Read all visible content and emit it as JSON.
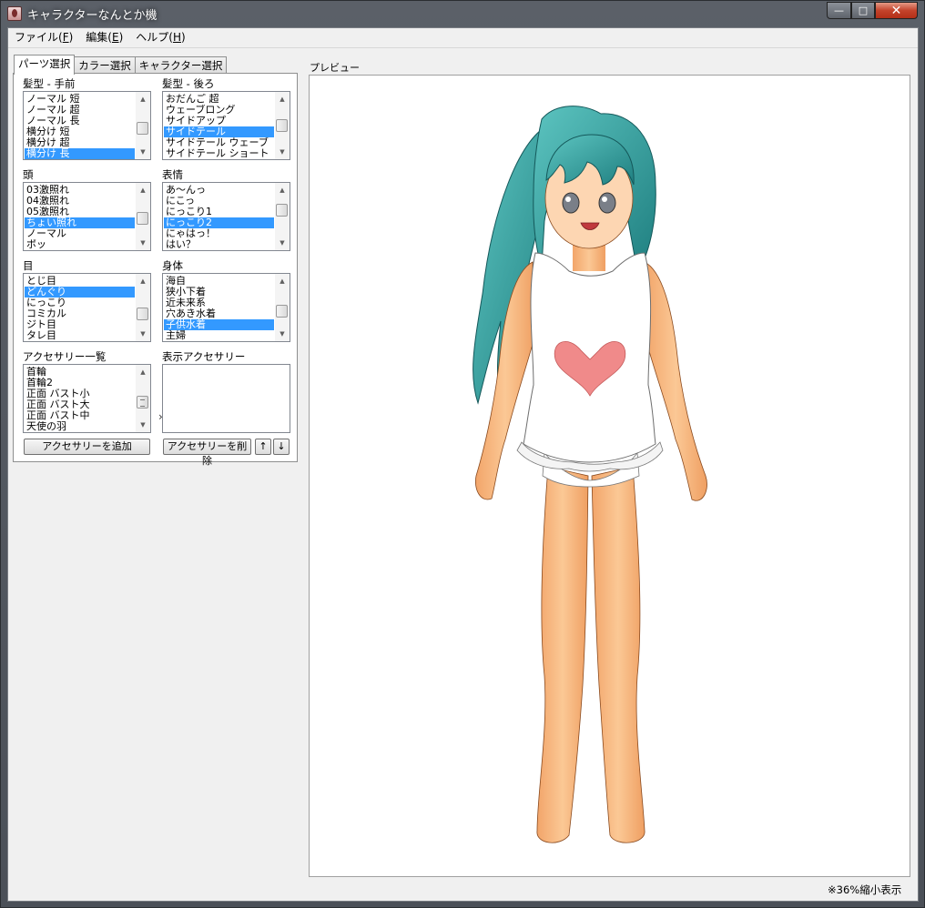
{
  "window": {
    "title": "キャラクターなんとか機",
    "caption": {
      "minimize": "—",
      "maximize": "□",
      "close": "✕"
    }
  },
  "menu": [
    {
      "label": "ファイル(",
      "key": "F",
      "suffix": ")"
    },
    {
      "label": "編集(",
      "key": "E",
      "suffix": ")"
    },
    {
      "label": "ヘルプ(",
      "key": "H",
      "suffix": ")"
    }
  ],
  "tabs": [
    "パーツ選択",
    "カラー選択",
    "キャラクター選択"
  ],
  "parts": {
    "hair_front": {
      "label": "髪型 - 手前",
      "items": [
        "ノーマル 短",
        "ノーマル 超",
        "ノーマル 長",
        "横分け 短",
        "横分け 超",
        "横分け 長"
      ],
      "selected": "横分け 長"
    },
    "hair_back": {
      "label": "髪型 - 後ろ",
      "items": [
        "おだんご 超",
        "ウェーブロング",
        "サイドアップ",
        "サイドテール",
        "サイドテール ウェーブ",
        "サイドテール ショート"
      ],
      "selected": "サイドテール"
    },
    "head": {
      "label": "頭",
      "items": [
        "03激照れ",
        "04激照れ",
        "05激照れ",
        "ちょい照れ",
        "ノーマル",
        "ポッ"
      ],
      "selected": "ちょい照れ"
    },
    "expression": {
      "label": "表情",
      "items": [
        "あ〜んっ",
        "にこっ",
        "にっこり1",
        "にっこり2",
        "にゃはっ！",
        "はい？"
      ],
      "selected": "にっこり2"
    },
    "eyes": {
      "label": "目",
      "items": [
        "とじ目",
        "どんぐり",
        "にっこり",
        "コミカル",
        "ジト目",
        "タレ目"
      ],
      "selected": "どんぐり"
    },
    "body": {
      "label": "身体",
      "items": [
        "海自",
        "狭小下着",
        "近未来系",
        "穴あき水着",
        "子供水着",
        "主婦"
      ],
      "selected": "子供水着"
    },
    "accessory_list": {
      "label": "アクセサリー一覧",
      "items": [
        "首輪",
        "首輪2",
        "正面 バスト小",
        "正面 バスト大",
        "正面 バスト中",
        "天使の羽"
      ],
      "selected": ""
    },
    "shown_accessory": {
      "label": "表示アクセサリー",
      "items": [],
      "selected": ""
    }
  },
  "buttons": {
    "move_right": "›",
    "add_accessory": "アクセサリーを追加",
    "remove_accessory": "アクセサリーを削除",
    "move_up": "↑",
    "move_down": "↓"
  },
  "preview": {
    "label": "プレビュー",
    "zoom_note": "※36%縮小表示",
    "colors": {
      "hair": "#3aa8a4",
      "skin": "#f7b77e",
      "shirt": "#ffffff",
      "heart": "#f08a8a",
      "eyes": "#7a7f88"
    }
  }
}
